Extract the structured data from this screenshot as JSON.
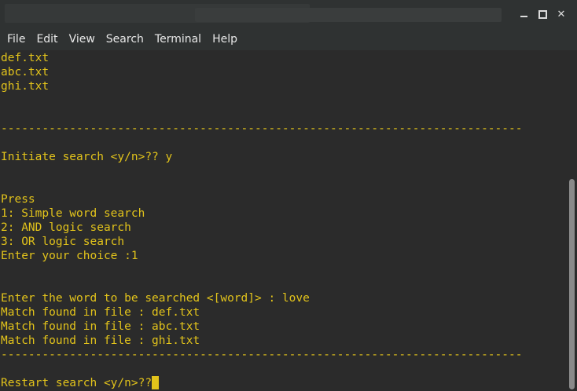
{
  "window": {
    "title": "",
    "controls": {
      "minimize": "minimize",
      "maximize": "maximize",
      "close": "✕"
    }
  },
  "menu": {
    "file": "File",
    "edit": "Edit",
    "view": "View",
    "search": "Search",
    "terminal": "Terminal",
    "help": "Help"
  },
  "terminal": {
    "lines": [
      "def.txt",
      "abc.txt",
      "ghi.txt",
      "",
      "",
      "----------------------------------------------------------------------------",
      "",
      "Initiate search <y/n>?? y",
      "",
      "",
      "Press",
      "1: Simple word search",
      "2: AND logic search",
      "3: OR logic search",
      "Enter your choice :1",
      "",
      "",
      "Enter the word to be searched <[word]> : love",
      "Match found in file : def.txt",
      "Match found in file : abc.txt",
      "Match found in file : ghi.txt",
      "----------------------------------------------------------------------------",
      "",
      "Restart search <y/n>??"
    ],
    "text_color": "#e2c31b",
    "background": "#2b2b2b"
  },
  "scrollbar": {
    "position_fraction": 0.38
  }
}
